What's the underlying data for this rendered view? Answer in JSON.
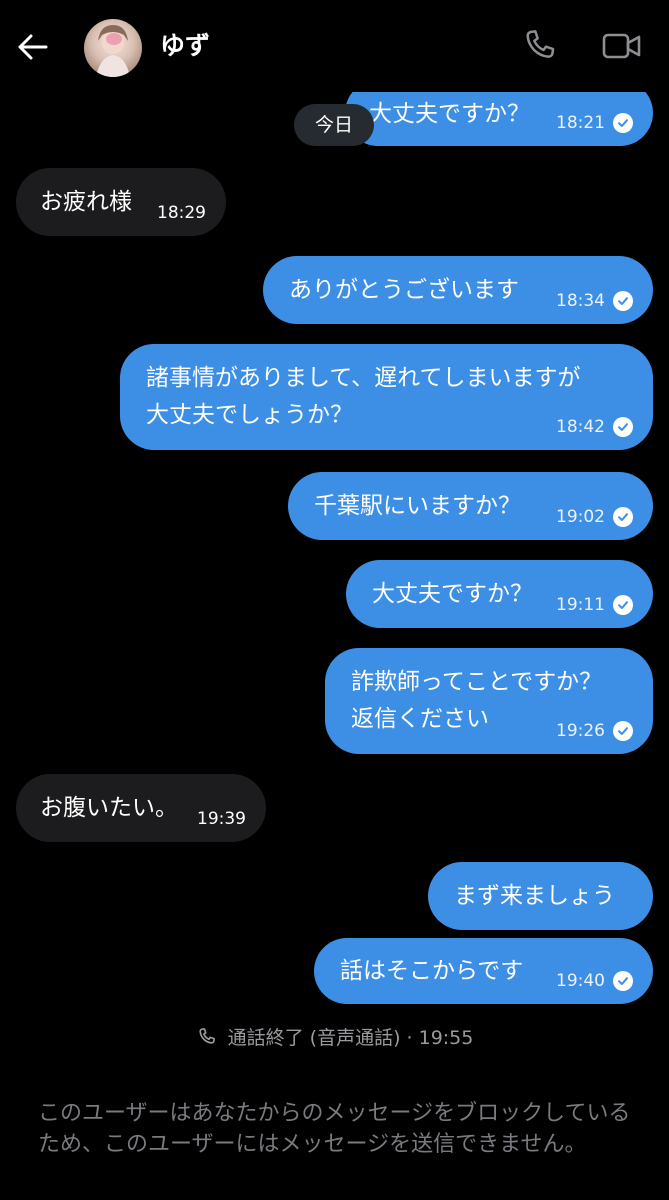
{
  "header": {
    "contact_name": "ゆず",
    "back_icon": "back-arrow-icon",
    "call_icon": "phone-icon",
    "video_icon": "video-camera-icon"
  },
  "day_separator": "今日",
  "messages": [
    {
      "dir": "out",
      "lines": [
        "大丈夫ですか？"
      ],
      "time": "18:21",
      "read": true
    },
    {
      "dir": "in",
      "lines": [
        "お疲れ様"
      ],
      "time": "18:29"
    },
    {
      "dir": "out",
      "lines": [
        "ありがとうございます"
      ],
      "time": "18:34",
      "read": true
    },
    {
      "dir": "out",
      "lines": [
        "諸事情がありまして、遅れてしまいますが",
        "大丈夫でしょうか？"
      ],
      "time": "18:42",
      "read": true
    },
    {
      "dir": "out",
      "lines": [
        "千葉駅にいますか？"
      ],
      "time": "19:02",
      "read": true
    },
    {
      "dir": "out",
      "lines": [
        "大丈夫ですか？"
      ],
      "time": "19:11",
      "read": true
    },
    {
      "dir": "out",
      "lines": [
        "詐欺師ってことですか？",
        "返信ください"
      ],
      "time": "19:26",
      "read": true
    },
    {
      "dir": "in",
      "lines": [
        "お腹いたい。"
      ],
      "time": "19:39"
    },
    {
      "dir": "out",
      "lines": [
        "まず来ましょう"
      ],
      "time": ""
    },
    {
      "dir": "out",
      "lines": [
        "話はそこからです"
      ],
      "time": "19:40",
      "read": true
    }
  ],
  "call_log": {
    "text": "通話終了 (音声通話) · 19:55",
    "icon": "phone-icon"
  },
  "footer_notice": "このユーザーはあなたからのメッセージをブロックしているため、このユーザーにはメッセージを送信できません。",
  "colors": {
    "background": "#000000",
    "outgoing_bubble": "#3d8fe5",
    "incoming_bubble": "#1c1c1f",
    "day_separator": "#262b32",
    "muted_text": "#9a9a9f"
  }
}
